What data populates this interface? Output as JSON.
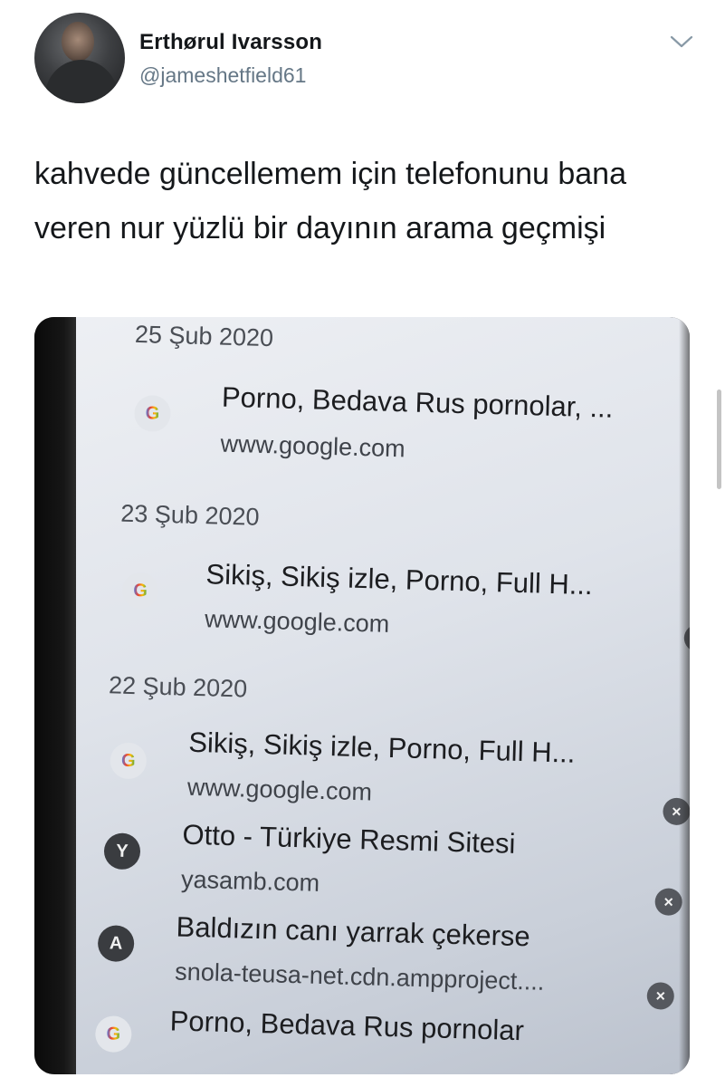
{
  "tweet": {
    "display_name": "Erthørul Ivarsson",
    "handle": "@jameshetfield61",
    "text": "kahvede güncellemem için telefonunu bana veren nur yüzlü bir dayının arama geçmişi",
    "menu_icon": "chevron-down-icon"
  },
  "history": {
    "groups": [
      {
        "date": "25 Şub 2020",
        "items": [
          {
            "icon": "G",
            "icon_name": "google-icon",
            "title": "Porno, Bedava Rus pornolar, ...",
            "url": "www.google.com"
          }
        ]
      },
      {
        "date": "23 Şub 2020",
        "items": [
          {
            "icon": "G",
            "icon_name": "google-icon",
            "title": "Sikiş, Sikiş izle, Porno, Full H...",
            "url": "www.google.com"
          }
        ]
      },
      {
        "date": "22 Şub 2020",
        "items": [
          {
            "icon": "G",
            "icon_name": "google-icon",
            "title": "Sikiş, Sikiş izle, Porno, Full H...",
            "url": "www.google.com"
          },
          {
            "icon": "Y",
            "icon_name": "site-letter-icon",
            "title": "Otto - Türkiye Resmi Sitesi",
            "url": "yasamb.com"
          },
          {
            "icon": "A",
            "icon_name": "site-letter-icon",
            "title": "Baldızın canı yarrak çekerse",
            "url": "snola-teusa-net.cdn.ampproject...."
          },
          {
            "icon": "G",
            "icon_name": "google-icon",
            "title": "Porno, Bedava Rus pornolar",
            "url": ""
          }
        ]
      }
    ],
    "close_glyph": "×"
  }
}
